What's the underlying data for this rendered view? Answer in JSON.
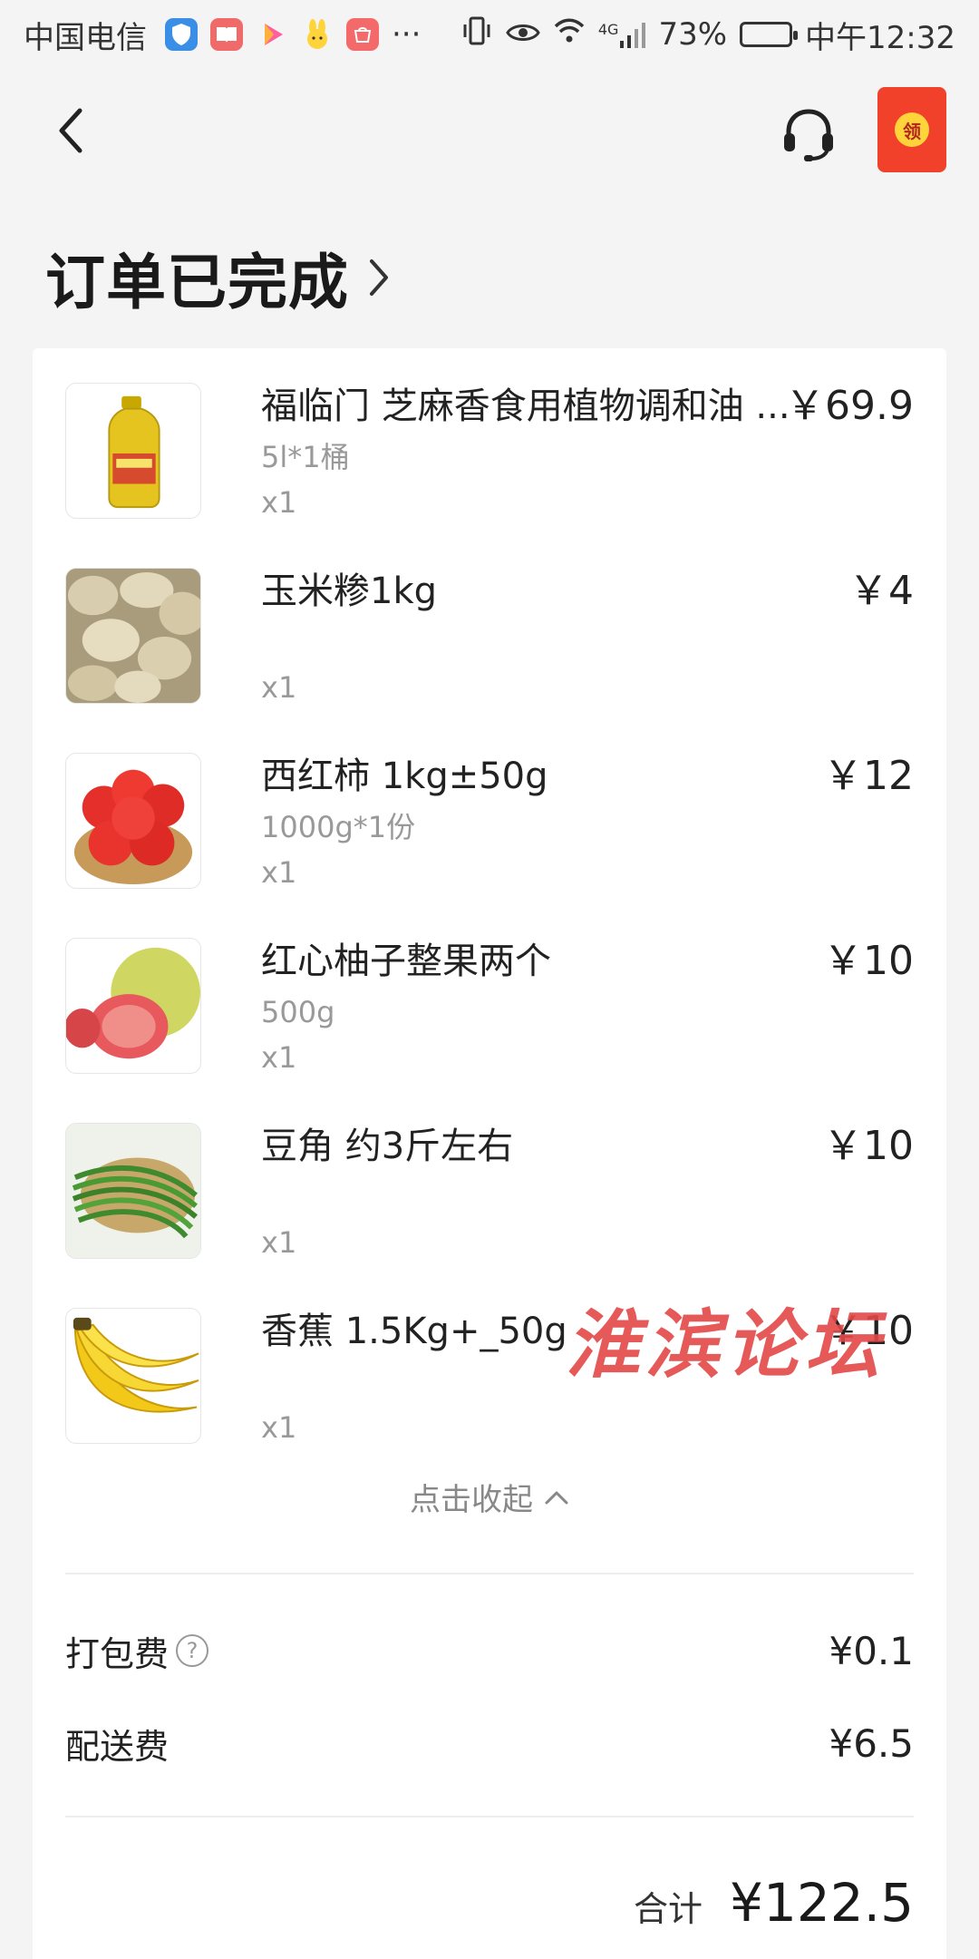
{
  "status_bar": {
    "carrier": "中国电信",
    "more": "···",
    "network": "4G",
    "battery": "73%",
    "battery_level": 0.73,
    "time": "中午12:32"
  },
  "header": {
    "title": "订单已完成",
    "red_packet_label": "领"
  },
  "items": [
    {
      "name": "福临门 芝麻香食用植物调和油 ...",
      "spec": "5l*1桶",
      "qty": "x1",
      "price": "￥69.9"
    },
    {
      "name": "玉米糁1kg",
      "spec": "",
      "qty": "x1",
      "price": "￥4"
    },
    {
      "name": "西红柿 1kg±50g",
      "spec": "1000g*1份",
      "qty": "x1",
      "price": "￥12"
    },
    {
      "name": "红心柚子整果两个",
      "spec": "500g",
      "qty": "x1",
      "price": "￥10"
    },
    {
      "name": "豆角 约3斤左右",
      "spec": "",
      "qty": "x1",
      "price": "￥10"
    },
    {
      "name": "香蕉 1.5Kg+_50g",
      "spec": "",
      "qty": "x1",
      "price": "￥10"
    }
  ],
  "collapse_label": "点击收起",
  "fees": [
    {
      "label": "打包费",
      "value": "¥0.1"
    },
    {
      "label": "配送费",
      "value": "¥6.5"
    }
  ],
  "total": {
    "label": "合计",
    "value": "¥122.5"
  },
  "watermark": "淮滨论坛",
  "colors": {
    "red_packet": "#f2412b",
    "watermark": "#e44848"
  }
}
